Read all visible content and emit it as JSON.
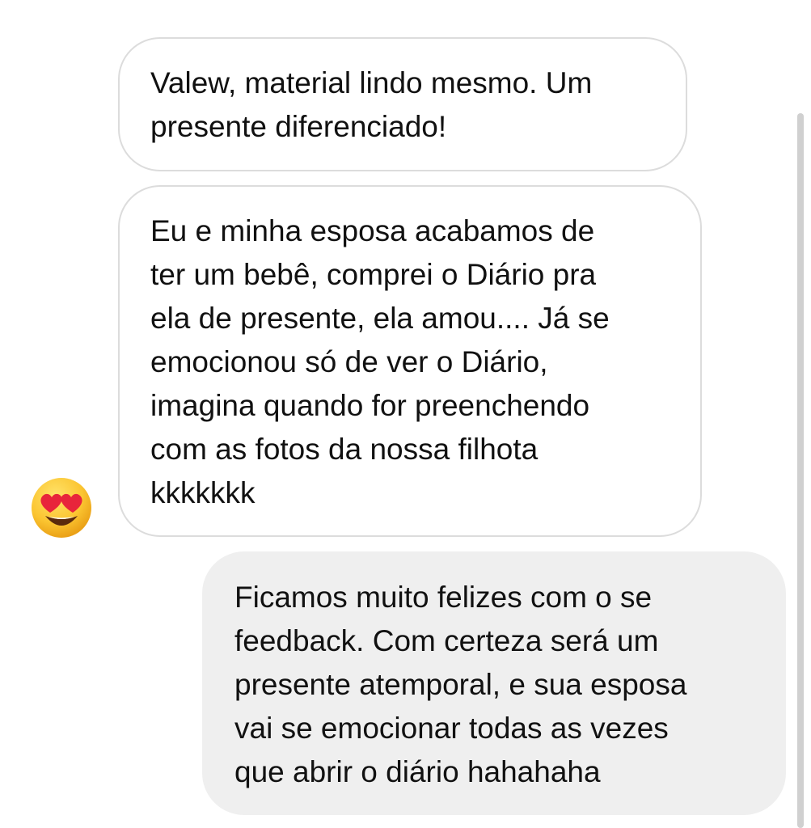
{
  "messages": [
    {
      "direction": "received",
      "text": "Valew, material lindo mesmo. Um\npresente diferenciado!"
    },
    {
      "direction": "received",
      "text": "Eu e minha esposa acabamos de\nter um bebê, comprei o Diário pra\nela de presente, ela amou.... Já se\nemocionou só de ver o Diário,\nimagina quando for preenchendo\ncom as fotos da nossa filhota\nkkkkkkk",
      "reaction": {
        "icon": "heart-eyes-emoji-icon"
      }
    },
    {
      "direction": "sent",
      "text": "Ficamos muito felizes com o se\nfeedback. Com certeza será um\npresente atemporal, e sua esposa\nvai se emocionar todas as vezes\nque abrir o diário hahahaha"
    }
  ],
  "colors": {
    "received_bubble_border": "#dcdcdc",
    "sent_bubble_background": "#efefef",
    "text": "#111111",
    "scrollbar": "#d0d0d0"
  }
}
